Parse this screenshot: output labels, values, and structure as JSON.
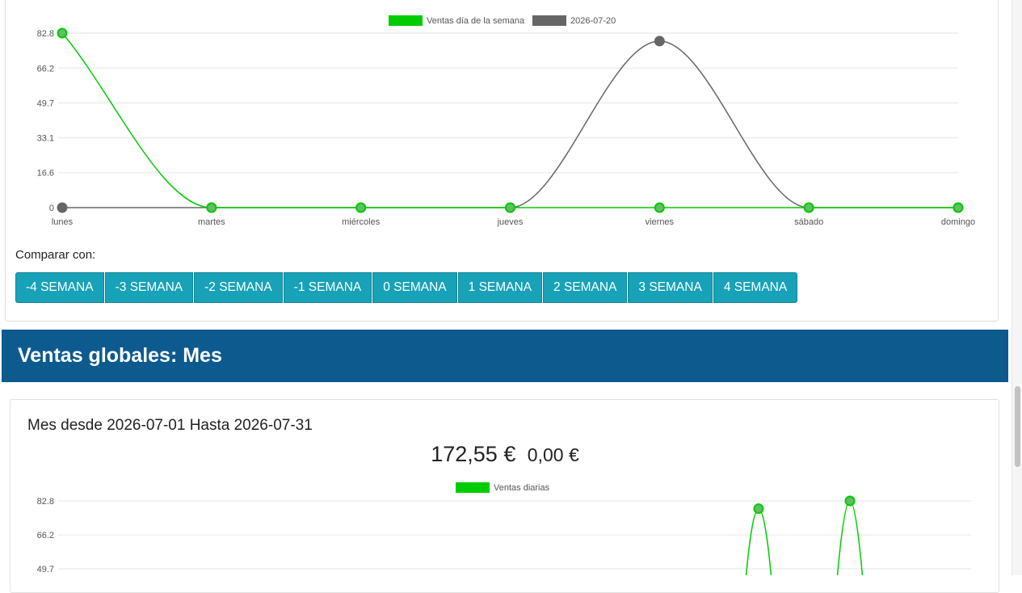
{
  "week_chart": {
    "chart_data": {
      "type": "line",
      "categories": [
        "lunes",
        "martes",
        "miércoles",
        "jueves",
        "viernes",
        "sábado",
        "domingo"
      ],
      "y_ticks": [
        "0",
        "16.6",
        "33.1",
        "49.7",
        "66.2",
        "82.8"
      ],
      "ylim": [
        0,
        82.8
      ],
      "series": [
        {
          "name": "Ventas día de la semana",
          "color": "#00cc00",
          "values": [
            82.8,
            0,
            0,
            0,
            0,
            0,
            0
          ]
        },
        {
          "name": "2026-07-20",
          "color": "#666666",
          "values": [
            0,
            0,
            0,
            0,
            79,
            0,
            0
          ]
        }
      ],
      "legend": "top-center",
      "grid": true
    }
  },
  "compare": {
    "label": "Comparar con:",
    "buttons": [
      "-4 SEMANA",
      "-3 SEMANA",
      "-2 SEMANA",
      "-1 SEMANA",
      "0 SEMANA",
      "1 SEMANA",
      "2 SEMANA",
      "3 SEMANA",
      "4 SEMANA"
    ]
  },
  "section": {
    "title": "Ventas globales: Mes"
  },
  "month": {
    "range_label": "Mes desde 2026-07-01 Hasta 2026-07-31",
    "total_main": "172,55 €",
    "total_secondary": "0,00 €",
    "chart_data": {
      "type": "line",
      "y_ticks": [
        "49.7",
        "66.2",
        "82.8"
      ],
      "ylim": [
        0,
        82.8
      ],
      "series": [
        {
          "name": "Ventas diarias",
          "color": "#00cc00"
        }
      ],
      "peaks": [
        79,
        82.8
      ],
      "legend": "top-center",
      "grid": true
    }
  }
}
